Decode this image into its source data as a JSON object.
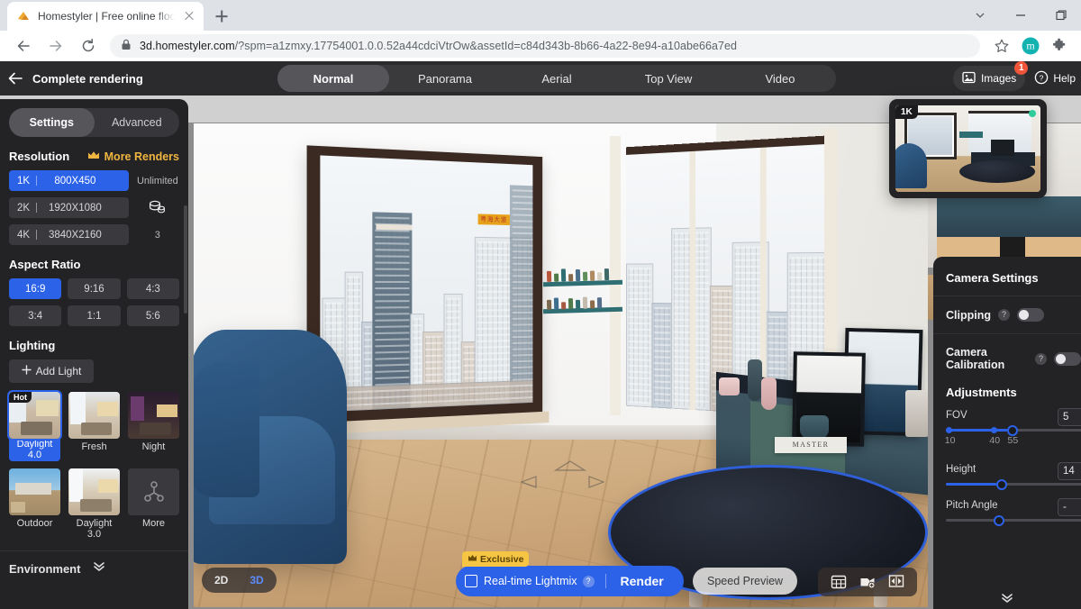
{
  "browser": {
    "tab": {
      "title": "Homestyler | Free online floor pla",
      "favicon_icon": "homestyler-favicon",
      "close_icon": "close-icon"
    },
    "newtab_icon": "plus-icon",
    "window_controls": [
      {
        "name": "chrome-tab-search",
        "icon": "chevron-down-icon"
      },
      {
        "name": "window-minimize",
        "icon": "minimize-icon"
      },
      {
        "name": "window-maximize",
        "icon": "maximize-icon"
      }
    ],
    "nav": {
      "back_icon": "back-arrow-icon",
      "forward_icon": "forward-arrow-icon",
      "reload_icon": "reload-icon"
    },
    "omnibox": {
      "lock_icon": "lock-icon",
      "url_domain": "3d.homestyler.com",
      "url_path": "/?spm=a1zmxy.17754001.0.0.52a44cdciVtrOw&assetId=c84d343b-8b66-4a22-8e94-a10abe66a7ed"
    },
    "toolbar_icons": [
      {
        "name": "bookmark-star-icon",
        "glyph": "star"
      },
      {
        "name": "profile-avatar",
        "glyph": "m"
      },
      {
        "name": "extensions-puzzle-icon",
        "glyph": "puzzle"
      }
    ]
  },
  "header": {
    "back_icon": "back-arrow-icon",
    "title": "Complete rendering",
    "tabs": [
      {
        "label": "Normal",
        "active": true
      },
      {
        "label": "Panorama",
        "active": false
      },
      {
        "label": "Aerial",
        "active": false
      },
      {
        "label": "Top View",
        "active": false
      },
      {
        "label": "Video",
        "active": false
      }
    ],
    "images_button": {
      "label": "Images",
      "icon": "image-icon",
      "badge": "1"
    },
    "help_button": {
      "label": "Help",
      "icon": "question-circle-icon"
    }
  },
  "sidebar": {
    "segments": [
      {
        "label": "Settings",
        "active": true
      },
      {
        "label": "Advanced",
        "active": false
      }
    ],
    "resolution": {
      "title": "Resolution",
      "more_renders": {
        "label": "More Renders",
        "icon": "crown-icon",
        "color": "#f0b540"
      },
      "rows": [
        {
          "key": "1K",
          "value": "800X450",
          "side": "Unlimited",
          "side_type": "text",
          "active": true
        },
        {
          "key": "2K",
          "value": "1920X1080",
          "side": "",
          "side_type": "coins-icon",
          "active": false
        },
        {
          "key": "4K",
          "value": "3840X2160",
          "side": "3",
          "side_type": "text",
          "active": false
        }
      ]
    },
    "aspect_ratio": {
      "title": "Aspect Ratio",
      "options": [
        {
          "label": "16:9",
          "active": true
        },
        {
          "label": "9:16",
          "active": false
        },
        {
          "label": "4:3",
          "active": false
        },
        {
          "label": "3:4",
          "active": false
        },
        {
          "label": "1:1",
          "active": false
        },
        {
          "label": "5:6",
          "active": false
        }
      ]
    },
    "lighting": {
      "title": "Lighting",
      "add_light": {
        "label": "Add Light",
        "icon": "plus-icon"
      },
      "presets": [
        {
          "label": "Daylight 4.0",
          "tag": "Hot",
          "selected": true
        },
        {
          "label": "Fresh",
          "tag": "",
          "selected": false
        },
        {
          "label": "Night",
          "tag": "",
          "selected": false
        },
        {
          "label": "Outdoor",
          "tag": "",
          "selected": false
        },
        {
          "label": "Daylight 3.0",
          "tag": "",
          "selected": false
        },
        {
          "label": "More",
          "tag": "",
          "selected": false,
          "icon": "more-nodes-icon"
        }
      ]
    },
    "environment": {
      "title": "Environment",
      "collapse_icon": "double-chevron-down-icon"
    }
  },
  "right_panel": {
    "title": "Camera Settings",
    "clipping": {
      "label": "Clipping",
      "help_icon": "question-icon",
      "enabled": false
    },
    "camera_calibration": {
      "label": "Camera Calibration",
      "help_icon": "question-icon",
      "enabled": false
    },
    "adjustments_title": "Adjustments",
    "sliders": [
      {
        "name": "FOV",
        "value": "5",
        "ticks": [
          "10",
          "40",
          "55"
        ],
        "fill_pct": 44,
        "knob_pct": 44
      },
      {
        "name": "Height",
        "value": "14",
        "ticks": [],
        "fill_pct": 36,
        "knob_pct": 36
      },
      {
        "name": "Pitch Angle",
        "value": "-",
        "ticks": [],
        "fill_pct": 0,
        "knob_pct": 34
      }
    ],
    "collapse_icon": "double-chevron-down-icon"
  },
  "preview_card": {
    "quality_tag": "1K",
    "status_dot_color": "#2ecc9b",
    "image_alt": "rendered-room-thumbnail"
  },
  "bottom_bar": {
    "dimension_toggle": [
      {
        "label": "2D",
        "active": false
      },
      {
        "label": "3D",
        "active": true
      }
    ],
    "exclusive_badge": {
      "label": "Exclusive",
      "icon": "crown-icon",
      "color": "#f5c543"
    },
    "realtime_lightmix": {
      "label": "Real-time Lightmix",
      "checked": false,
      "help_icon": "question-icon"
    },
    "render_button": {
      "label": "Render",
      "color": "#2b62e8"
    },
    "speed_preview": {
      "label": "Speed Preview"
    },
    "tools": [
      {
        "name": "grid-view-icon"
      },
      {
        "name": "add-camera-icon"
      },
      {
        "name": "fit-width-icon"
      }
    ]
  },
  "scene": {
    "sign_text": "粤海大道",
    "book_text": "MASTER"
  }
}
